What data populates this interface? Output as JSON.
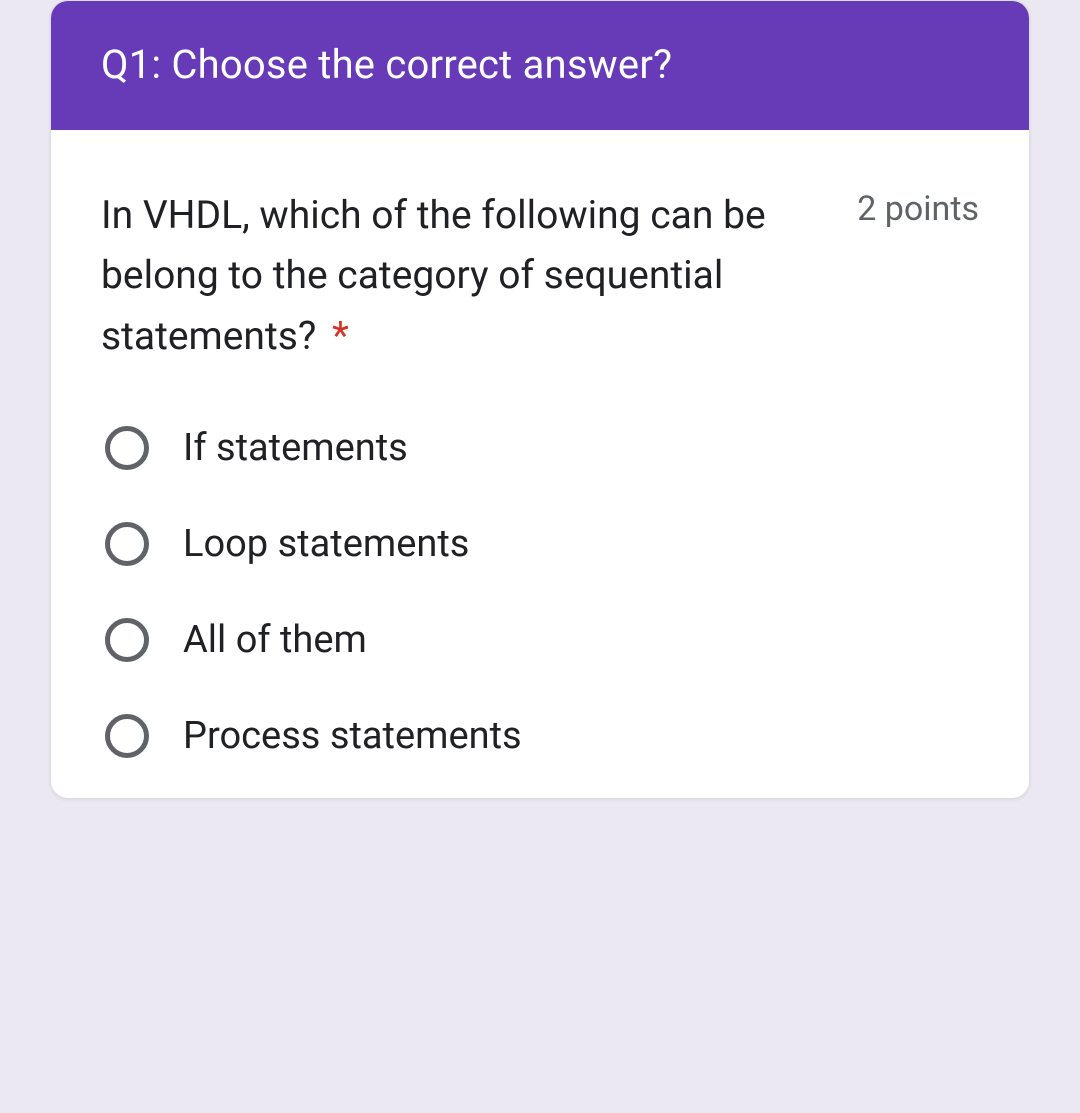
{
  "header": {
    "title": "Q1: Choose the correct answer?"
  },
  "question": {
    "text": "In VHDL, which of the following can be belong to the category of sequential statements?",
    "required_mark": "*",
    "points": "2 points"
  },
  "options": [
    {
      "label": "If statements"
    },
    {
      "label": "Loop statements"
    },
    {
      "label": "All of them"
    },
    {
      "label": "Process statements"
    }
  ]
}
